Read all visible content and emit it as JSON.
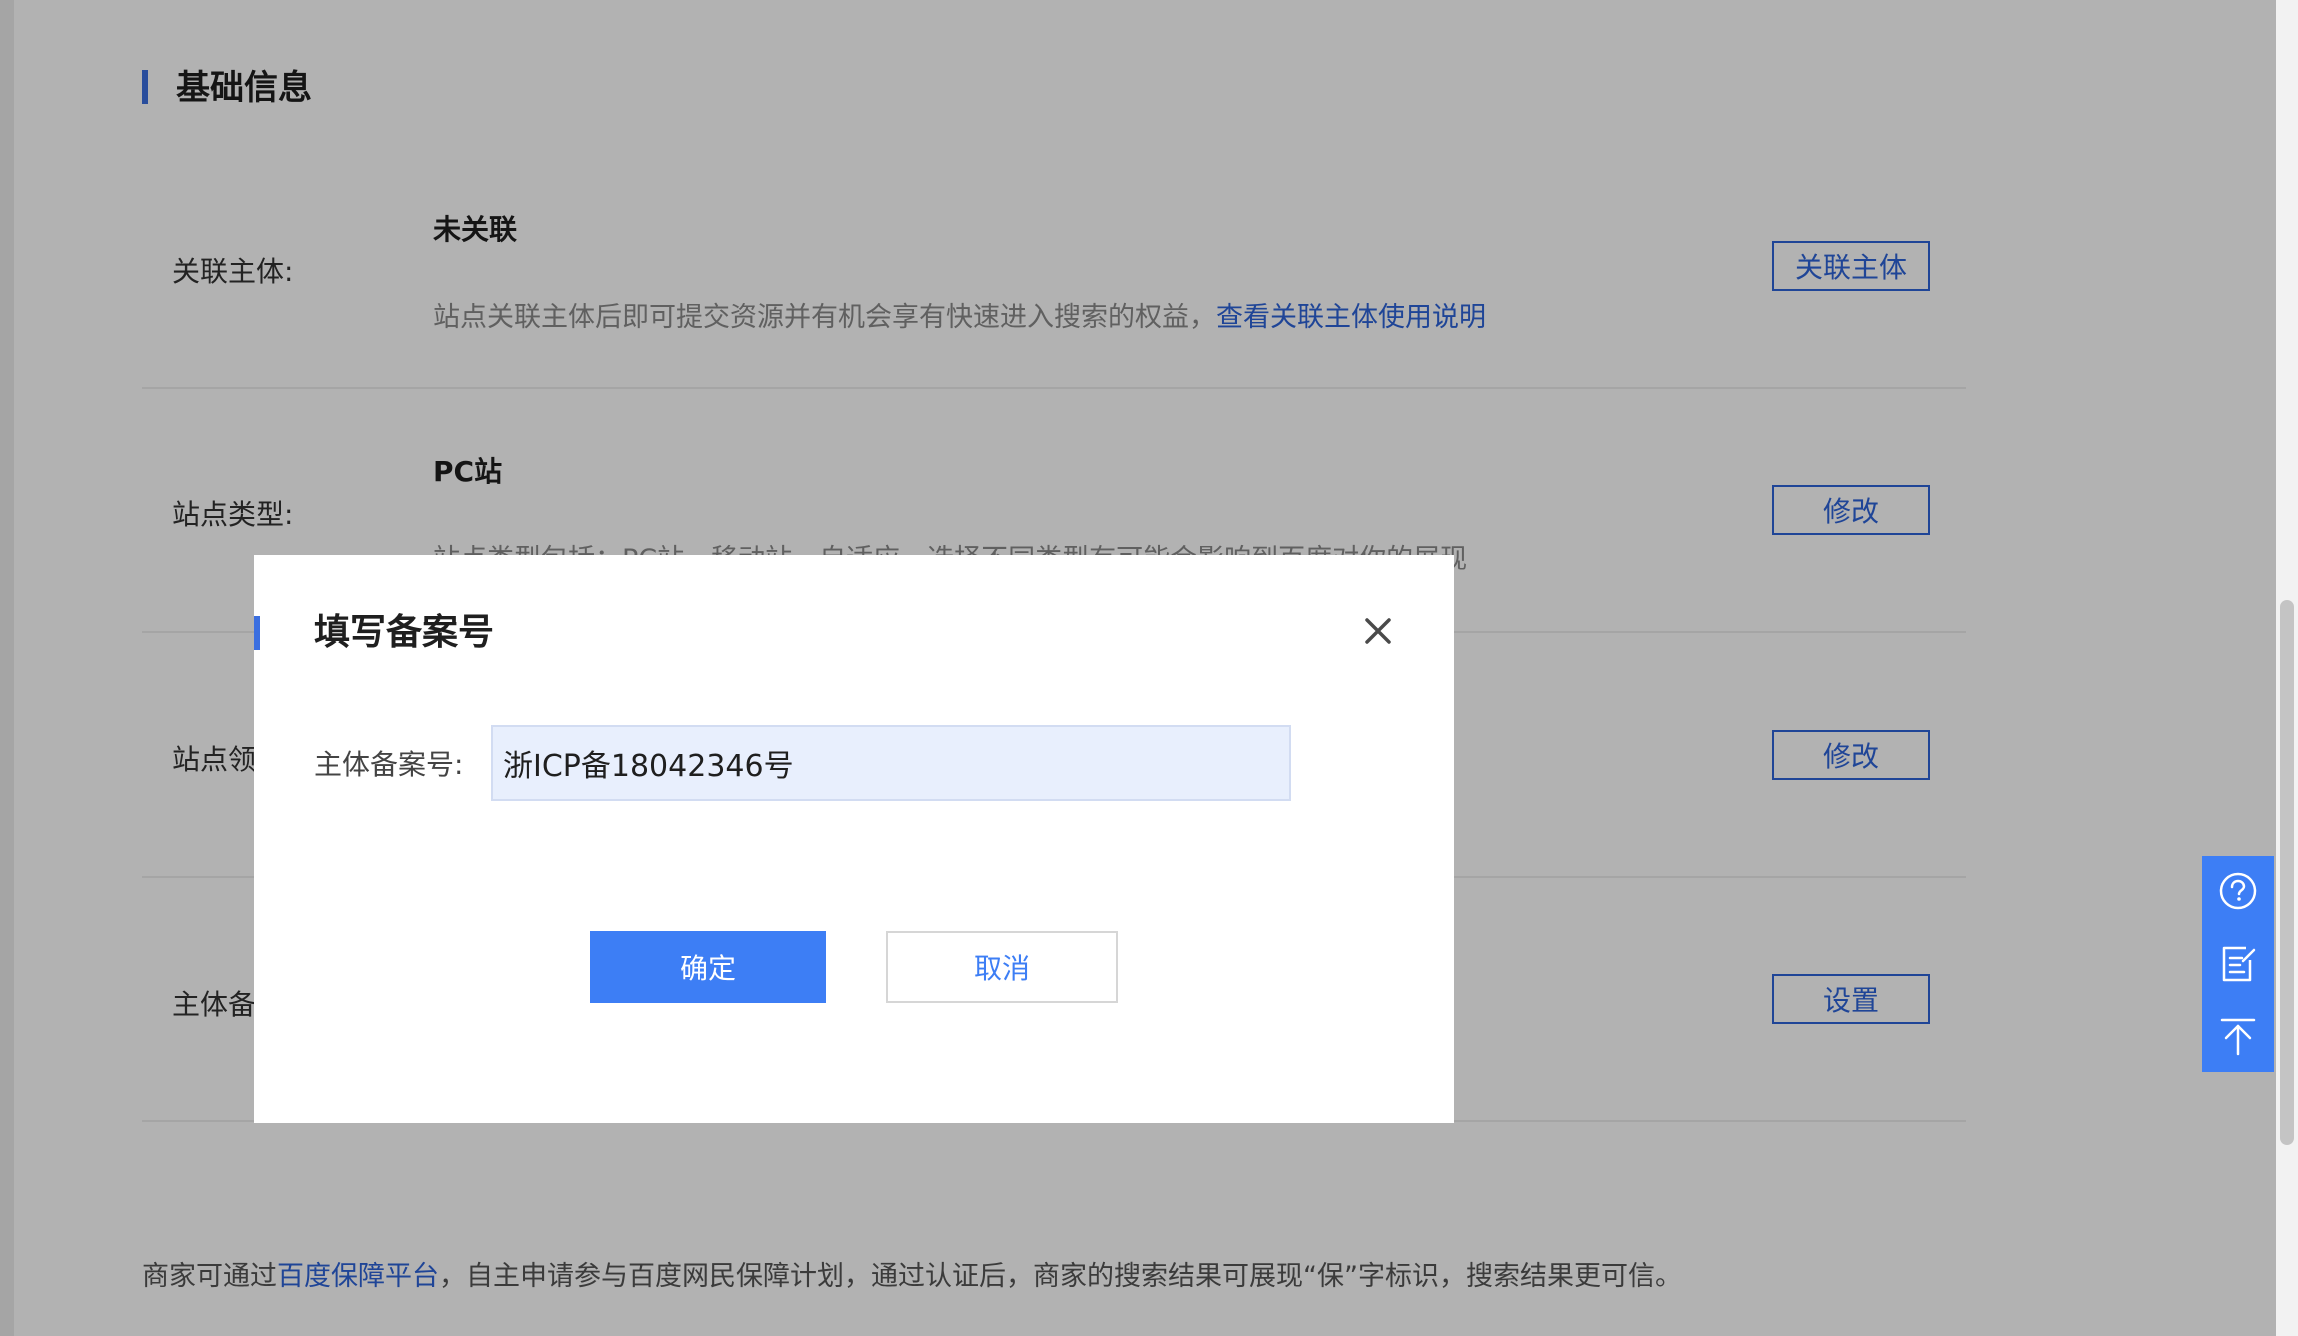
{
  "section": {
    "title": "基础信息"
  },
  "rows": [
    {
      "label": "关联主体:",
      "value": "未关联",
      "desc": "站点关联主体后即可提交资源并有机会享有快速进入搜索的权益，",
      "desc_link": "查看关联主体使用说明",
      "button": "关联主体"
    },
    {
      "label": "站点类型:",
      "value": "PC站",
      "desc": "站点类型包括：PC站、移动站、自适应，选择不同类型有可能会影响到百度对你的展现",
      "button": "修改"
    },
    {
      "label": "站点领",
      "button": "修改"
    },
    {
      "label": "主体备",
      "button": "设置"
    }
  ],
  "footer": {
    "prefix": "商家可通过",
    "link": "百度保障平台",
    "suffix": "，自主申请参与百度网民保障计划，通过认证后，商家的搜索结果可展现“保”字标识，搜索结果更可信。"
  },
  "dialog": {
    "title": "填写备案号",
    "field_label": "主体备案号:",
    "field_value": "浙ICP备18042346号",
    "confirm": "确定",
    "cancel": "取消",
    "close_icon": "close-icon"
  },
  "floating_tools": {
    "items": [
      "help-icon",
      "feedback-icon",
      "back-to-top-icon"
    ]
  },
  "colors": {
    "accent": "#3d7ef5",
    "link": "#2d63d8",
    "overlay": "rgba(0,0,0,0.30)"
  }
}
